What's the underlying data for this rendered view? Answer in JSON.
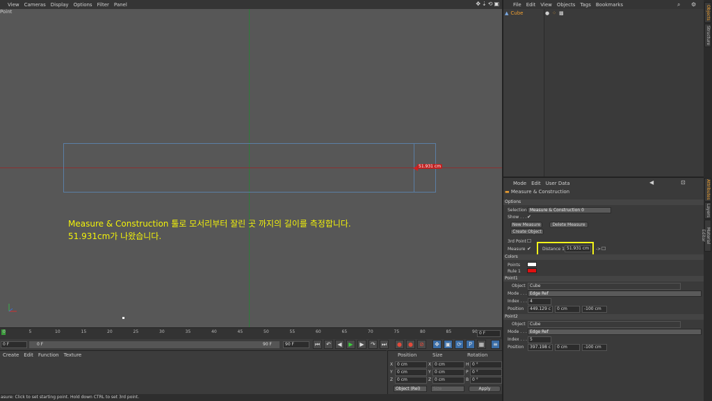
{
  "viewport": {
    "menu": [
      "View",
      "Cameras",
      "Display",
      "Options",
      "Filter",
      "Panel"
    ],
    "mode_label": "Point",
    "measure_value": "51.931 cm",
    "note_line1": "Measure & Construction 툴로 모서리부터 잘린 곳 까지의 길이를 측정합니다.",
    "note_line2": "51.931cm가 나왔습니다.",
    "axis_y": "Y",
    "axis_x": "X"
  },
  "timeline": {
    "ticks": [
      "0",
      "5",
      "10",
      "15",
      "20",
      "25",
      "30",
      "35",
      "40",
      "45",
      "50",
      "55",
      "60",
      "65",
      "70",
      "75",
      "80",
      "85",
      "90"
    ],
    "current_frame": "0 F",
    "start_field": "0 F",
    "range_start": "0 F",
    "range_end": "90 F",
    "end_field": "90 F"
  },
  "fcurve": {
    "menu": [
      "Create",
      "Edit",
      "Function",
      "Texture"
    ]
  },
  "coord": {
    "headers": [
      "Position",
      "Size",
      "Rotation"
    ],
    "rows": [
      {
        "axis": "X",
        "pos": "0 cm",
        "saxis": "X",
        "size": "0 cm",
        "raxis": "H",
        "rot": "0 °"
      },
      {
        "axis": "Y",
        "pos": "0 cm",
        "saxis": "Y",
        "size": "0 cm",
        "raxis": "P",
        "rot": "0 °"
      },
      {
        "axis": "Z",
        "pos": "0 cm",
        "saxis": "Z",
        "size": "0 cm",
        "raxis": "B",
        "rot": "0 °"
      }
    ],
    "mode_select": "Object (Rel)",
    "size_select": "Size",
    "apply": "Apply"
  },
  "status": "asure: Click to set starting point. Hold down CTRL to set 3rd point.",
  "object_manager": {
    "menu": [
      "File",
      "Edit",
      "View",
      "Objects",
      "Tags",
      "Bookmarks"
    ],
    "object_name": "Cube"
  },
  "attributes": {
    "menu": [
      "Mode",
      "Edit",
      "User Data"
    ],
    "title": "Measure & Construction",
    "options_header": "Options",
    "selection_label": "Selection",
    "selection_value": "Measure & Construction 0",
    "show_label": "Show . . .",
    "new_measure": "New Measure",
    "delete_measure": "Delete Measure",
    "create_object": "Create Object",
    "third_point": "3rd Point",
    "measure_label": "Measure",
    "distance_label": "Distance 1",
    "distance_value": "51.931 cm",
    "colors_header": "Colors",
    "points_label": "Points",
    "rule_label": "Rule 1",
    "point1_header": "Point1",
    "point2_header": "Point2",
    "object_label": "Object",
    "object_value": "Cube",
    "mode_label": "Mode . . .",
    "mode_value": "Edge Ref",
    "index_label": "Index . . .",
    "p1_index": "4",
    "p2_index": "5",
    "position_label": "Position",
    "p1_pos": [
      "449.129 c",
      "0 cm",
      "-100 cm"
    ],
    "p2_pos": [
      "397.198 c",
      "0 cm",
      "-100 cm"
    ],
    "colors": {
      "points": "#ffffff",
      "rule": "#e01010"
    }
  },
  "side_tabs": [
    "Objects",
    "Structure",
    "Attributes",
    "Layers",
    "Material Editor"
  ]
}
